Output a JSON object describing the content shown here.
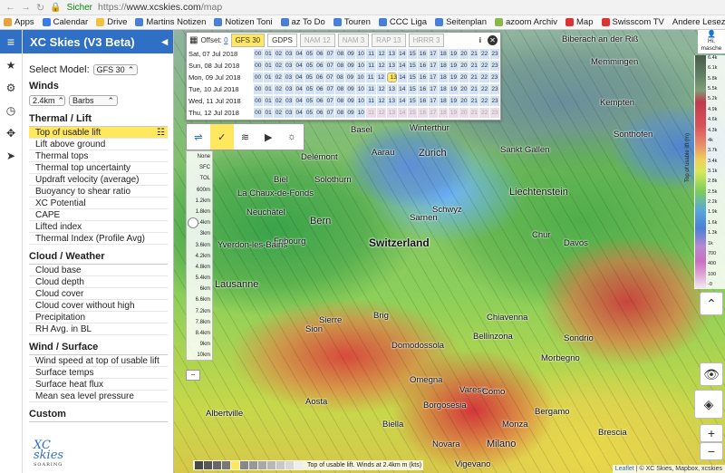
{
  "browser": {
    "secure_label": "Sicher",
    "url_scheme": "https://",
    "url_host": "www.xcskies.com",
    "url_path": "/map"
  },
  "bookmarks": [
    {
      "label": "Apps",
      "color": "#e8a33a"
    },
    {
      "label": "Calendar",
      "color": "#3a7be8"
    },
    {
      "label": "Drive",
      "color": "#f2c23a"
    },
    {
      "label": "Martins Notizen",
      "color": "#4a7fd6"
    },
    {
      "label": "Notizen Toni",
      "color": "#4a7fd6"
    },
    {
      "label": "az To Do",
      "color": "#4a7fd6"
    },
    {
      "label": "Touren",
      "color": "#4a7fd6"
    },
    {
      "label": "CCC Liga",
      "color": "#4a7fd6"
    },
    {
      "label": "Seitenplan",
      "color": "#4a7fd6"
    },
    {
      "label": "azoom Archiv",
      "color": "#8ab84a"
    },
    {
      "label": "Map",
      "color": "#d33"
    },
    {
      "label": "Swisscom TV",
      "color": "#d33"
    }
  ],
  "bookmarks_right": "Andere Lesezeichen",
  "sidebar": {
    "title": "XC Skies (V3 Beta)",
    "select_model_label": "Select Model:",
    "model_value": "GFS 30",
    "winds_label": "Winds",
    "winds_altitude": "2.4km",
    "winds_style": "Barbs",
    "sections": [
      {
        "title": "Thermal / Lift",
        "items": [
          "Top of usable lift",
          "Lift above ground",
          "Thermal tops",
          "Thermal top uncertainty",
          "Updraft velocity (average)",
          "Buoyancy to shear ratio",
          "XC Potential",
          "CAPE",
          "Lifted index",
          "Thermal Index (Profile Avg)"
        ]
      },
      {
        "title": "Cloud / Weather",
        "items": [
          "Cloud base",
          "Cloud depth",
          "Cloud cover",
          "Cloud cover without high",
          "Precipitation",
          "RH Avg. in BL"
        ]
      },
      {
        "title": "Wind / Surface",
        "items": [
          "Wind speed at top of usable lift",
          "Surface temps",
          "Surface heat flux",
          "Mean sea level pressure"
        ]
      },
      {
        "title": "Custom",
        "items": []
      }
    ],
    "logo_text": "XC skies",
    "logo_sub": "SOARING"
  },
  "timepanel": {
    "offset_label": "Offset:",
    "offset_value": "0",
    "models": [
      "GFS 30",
      "GDPS",
      "NAM 12",
      "NAM 3",
      "RAP 13",
      "HRRR 3"
    ],
    "days": [
      "Sat, 07 Jul 2018",
      "Sun, 08 Jul 2018",
      "Mon, 09 Jul 2018",
      "Tue, 10 Jul 2018",
      "Wed, 11 Jul 2018",
      "Thu, 12 Jul 2018"
    ],
    "hours": [
      "00",
      "01",
      "02",
      "03",
      "04",
      "05",
      "06",
      "07",
      "08",
      "09",
      "10",
      "11",
      "12",
      "13",
      "14",
      "15",
      "16",
      "17",
      "18",
      "19",
      "20",
      "21",
      "22",
      "23"
    ],
    "selected_day": 2,
    "selected_hour": 13,
    "last_day_available_until": 10
  },
  "altitudes": [
    "None",
    "SFC",
    "TOL",
    "600m",
    "1.2km",
    "1.8km",
    "2.4km",
    "3km",
    "3.6km",
    "4.2km",
    "4.8km",
    "5.4km",
    "6km",
    "6.6km",
    "7.2km",
    "7.8km",
    "8.4km",
    "9km",
    "10km"
  ],
  "map": {
    "cities": [
      {
        "name": "Basel",
        "cls": ""
      },
      {
        "name": "Winterthur",
        "cls": ""
      },
      {
        "name": "Zürich",
        "cls": "mid"
      },
      {
        "name": "Sankt Gallen",
        "cls": ""
      },
      {
        "name": "Aarau",
        "cls": ""
      },
      {
        "name": "Delémont",
        "cls": ""
      },
      {
        "name": "Solothurn",
        "cls": ""
      },
      {
        "name": "Biel",
        "cls": ""
      },
      {
        "name": "La Chaux-de-Fonds",
        "cls": ""
      },
      {
        "name": "Neuchâtel",
        "cls": ""
      },
      {
        "name": "Bern",
        "cls": "mid"
      },
      {
        "name": "Switzerland",
        "cls": "big"
      },
      {
        "name": "Liechtenstein",
        "cls": "mid"
      },
      {
        "name": "Schwyz",
        "cls": ""
      },
      {
        "name": "Sarnen",
        "cls": ""
      },
      {
        "name": "Chur",
        "cls": ""
      },
      {
        "name": "Davos",
        "cls": ""
      },
      {
        "name": "Fribourg",
        "cls": ""
      },
      {
        "name": "Yverdon-les-Bains",
        "cls": ""
      },
      {
        "name": "Lausanne",
        "cls": "mid"
      },
      {
        "name": "Sion",
        "cls": ""
      },
      {
        "name": "Sierre",
        "cls": ""
      },
      {
        "name": "Brig",
        "cls": ""
      },
      {
        "name": "Bellinzona",
        "cls": ""
      },
      {
        "name": "Chiavenna",
        "cls": ""
      },
      {
        "name": "Sondrio",
        "cls": ""
      },
      {
        "name": "Morbegno",
        "cls": ""
      },
      {
        "name": "Domodossola",
        "cls": ""
      },
      {
        "name": "Aosta",
        "cls": ""
      },
      {
        "name": "Omegna",
        "cls": ""
      },
      {
        "name": "Varese",
        "cls": ""
      },
      {
        "name": "Como",
        "cls": ""
      },
      {
        "name": "Bergamo",
        "cls": ""
      },
      {
        "name": "Borgosesia",
        "cls": ""
      },
      {
        "name": "Biella",
        "cls": ""
      },
      {
        "name": "Albertville",
        "cls": ""
      },
      {
        "name": "Milano",
        "cls": "mid"
      },
      {
        "name": "Monza",
        "cls": ""
      },
      {
        "name": "Novara",
        "cls": ""
      },
      {
        "name": "Brescia",
        "cls": ""
      },
      {
        "name": "Kempten",
        "cls": ""
      },
      {
        "name": "Memmingen",
        "cls": ""
      },
      {
        "name": "Biberach an der Riß",
        "cls": ""
      },
      {
        "name": "Sonthofen",
        "cls": ""
      },
      {
        "name": "Vigevano",
        "cls": ""
      }
    ],
    "legend_title": "Top of usable lift (m)",
    "legend_values": [
      "6.4k",
      "6.1k",
      "5.8k",
      "5.5k",
      "5.2k",
      "4.9k",
      "4.6k",
      "4.3k",
      "4k",
      "3.7k",
      "3.4k",
      "3.1k",
      "2.8k",
      "2.5k",
      "2.2k",
      "1.9k",
      "1.6k",
      "1.3k",
      "1k",
      "700",
      "400",
      "100",
      "-0"
    ],
    "user_label": "Hi, masche",
    "scale_text": "Top of usable lift. Winds at 2.4km m (kts)",
    "attribution_link": "Leaflet",
    "attribution_text": "| © XC Skies, Mapbox, xcskies",
    "zoom_in": "+",
    "zoom_out": "−"
  }
}
